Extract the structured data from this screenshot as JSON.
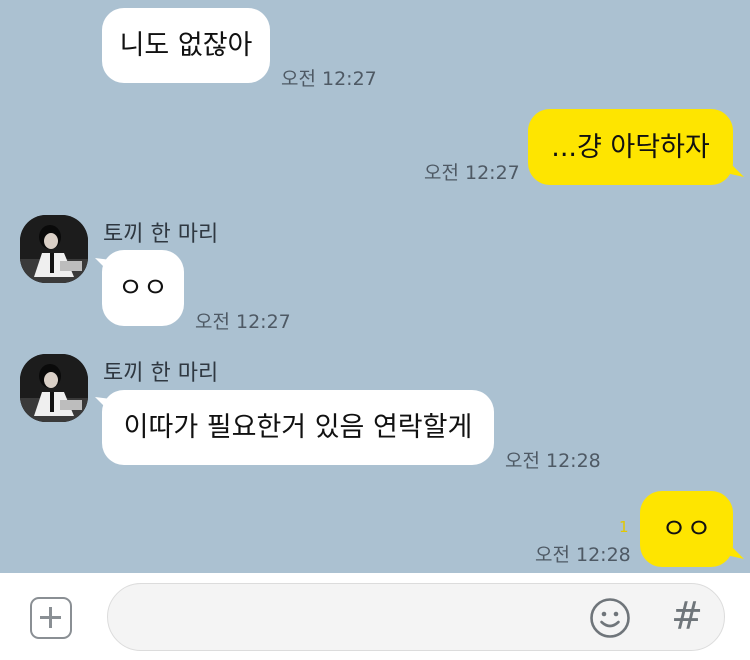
{
  "chat": {
    "messages": [
      {
        "text": "니도 없잖아",
        "time": "오전 12:27"
      },
      {
        "text": "...걍 아닥하자",
        "time": "오전 12:27"
      },
      {
        "sender": "토끼 한 마리",
        "text": "ㅇㅇ",
        "time": "오전 12:27"
      },
      {
        "sender": "토끼 한 마리",
        "text": "이따가 필요한거 있음 연락할게",
        "time": "오전 12:28"
      },
      {
        "text": "ㅇㅇ",
        "time": "오전 12:28",
        "unread": "1"
      }
    ]
  },
  "input": {
    "placeholder": "",
    "icons": [
      "plus-icon",
      "emoji-icon",
      "hashtag-icon"
    ],
    "hash_glyph": "#"
  },
  "colors": {
    "background": "#abc1d1",
    "my_bubble": "#fee500",
    "other_bubble": "#ffffff",
    "unread": "#e3c800"
  }
}
